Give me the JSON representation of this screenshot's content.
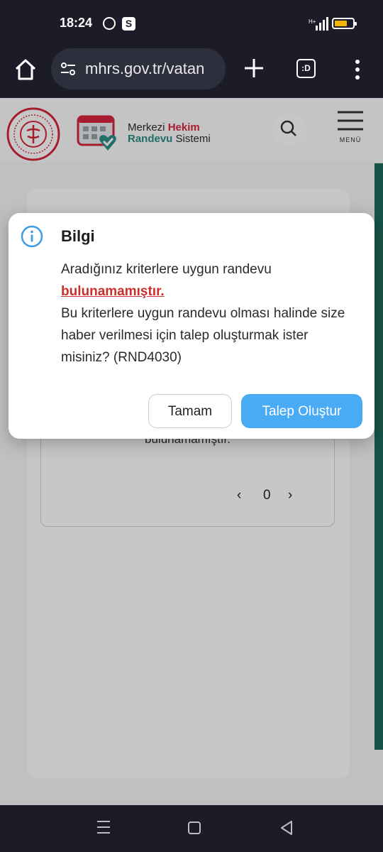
{
  "status_bar": {
    "time": "18:24",
    "icons": [
      "whatsapp-icon",
      "s-app-icon",
      "signal-icon",
      "battery-icon"
    ],
    "battery_level": 0.7
  },
  "browser": {
    "url": "mhrs.gov.tr/vatan",
    "tab_switcher_label": ":D",
    "icons": [
      "home-icon",
      "site-settings-icon",
      "new-tab-icon",
      "tab-switcher-icon",
      "more-menu-icon"
    ]
  },
  "site": {
    "brand_line1_a": "Merkezi ",
    "brand_line1_b": "Hekim",
    "brand_line2_a": "Randevu",
    "brand_line2_b": " Sistemi",
    "menu_label": "MENÜ",
    "colors": {
      "brand_red": "#d7263d",
      "brand_teal": "#2c8e86"
    }
  },
  "results": {
    "empty_text": "bulunamamıştır.",
    "page_number": "0",
    "prev": "‹",
    "next": "›"
  },
  "modal": {
    "title": "Bilgi",
    "line1": "Aradığınız kriterlere uygun randevu",
    "warning": "bulunamamıştır.",
    "line2": "Bu kriterlere uygun randevu olması halinde size haber verilmesi için talep oluşturmak ister misiniz? (RND4030)",
    "ok_label": "Tamam",
    "create_label": "Talep Oluştur",
    "colors": {
      "primary": "#4aabf5",
      "warning": "#c9302c"
    }
  },
  "nav_bar": {
    "icons": [
      "recent-apps-icon",
      "home-nav-icon",
      "back-icon"
    ]
  }
}
